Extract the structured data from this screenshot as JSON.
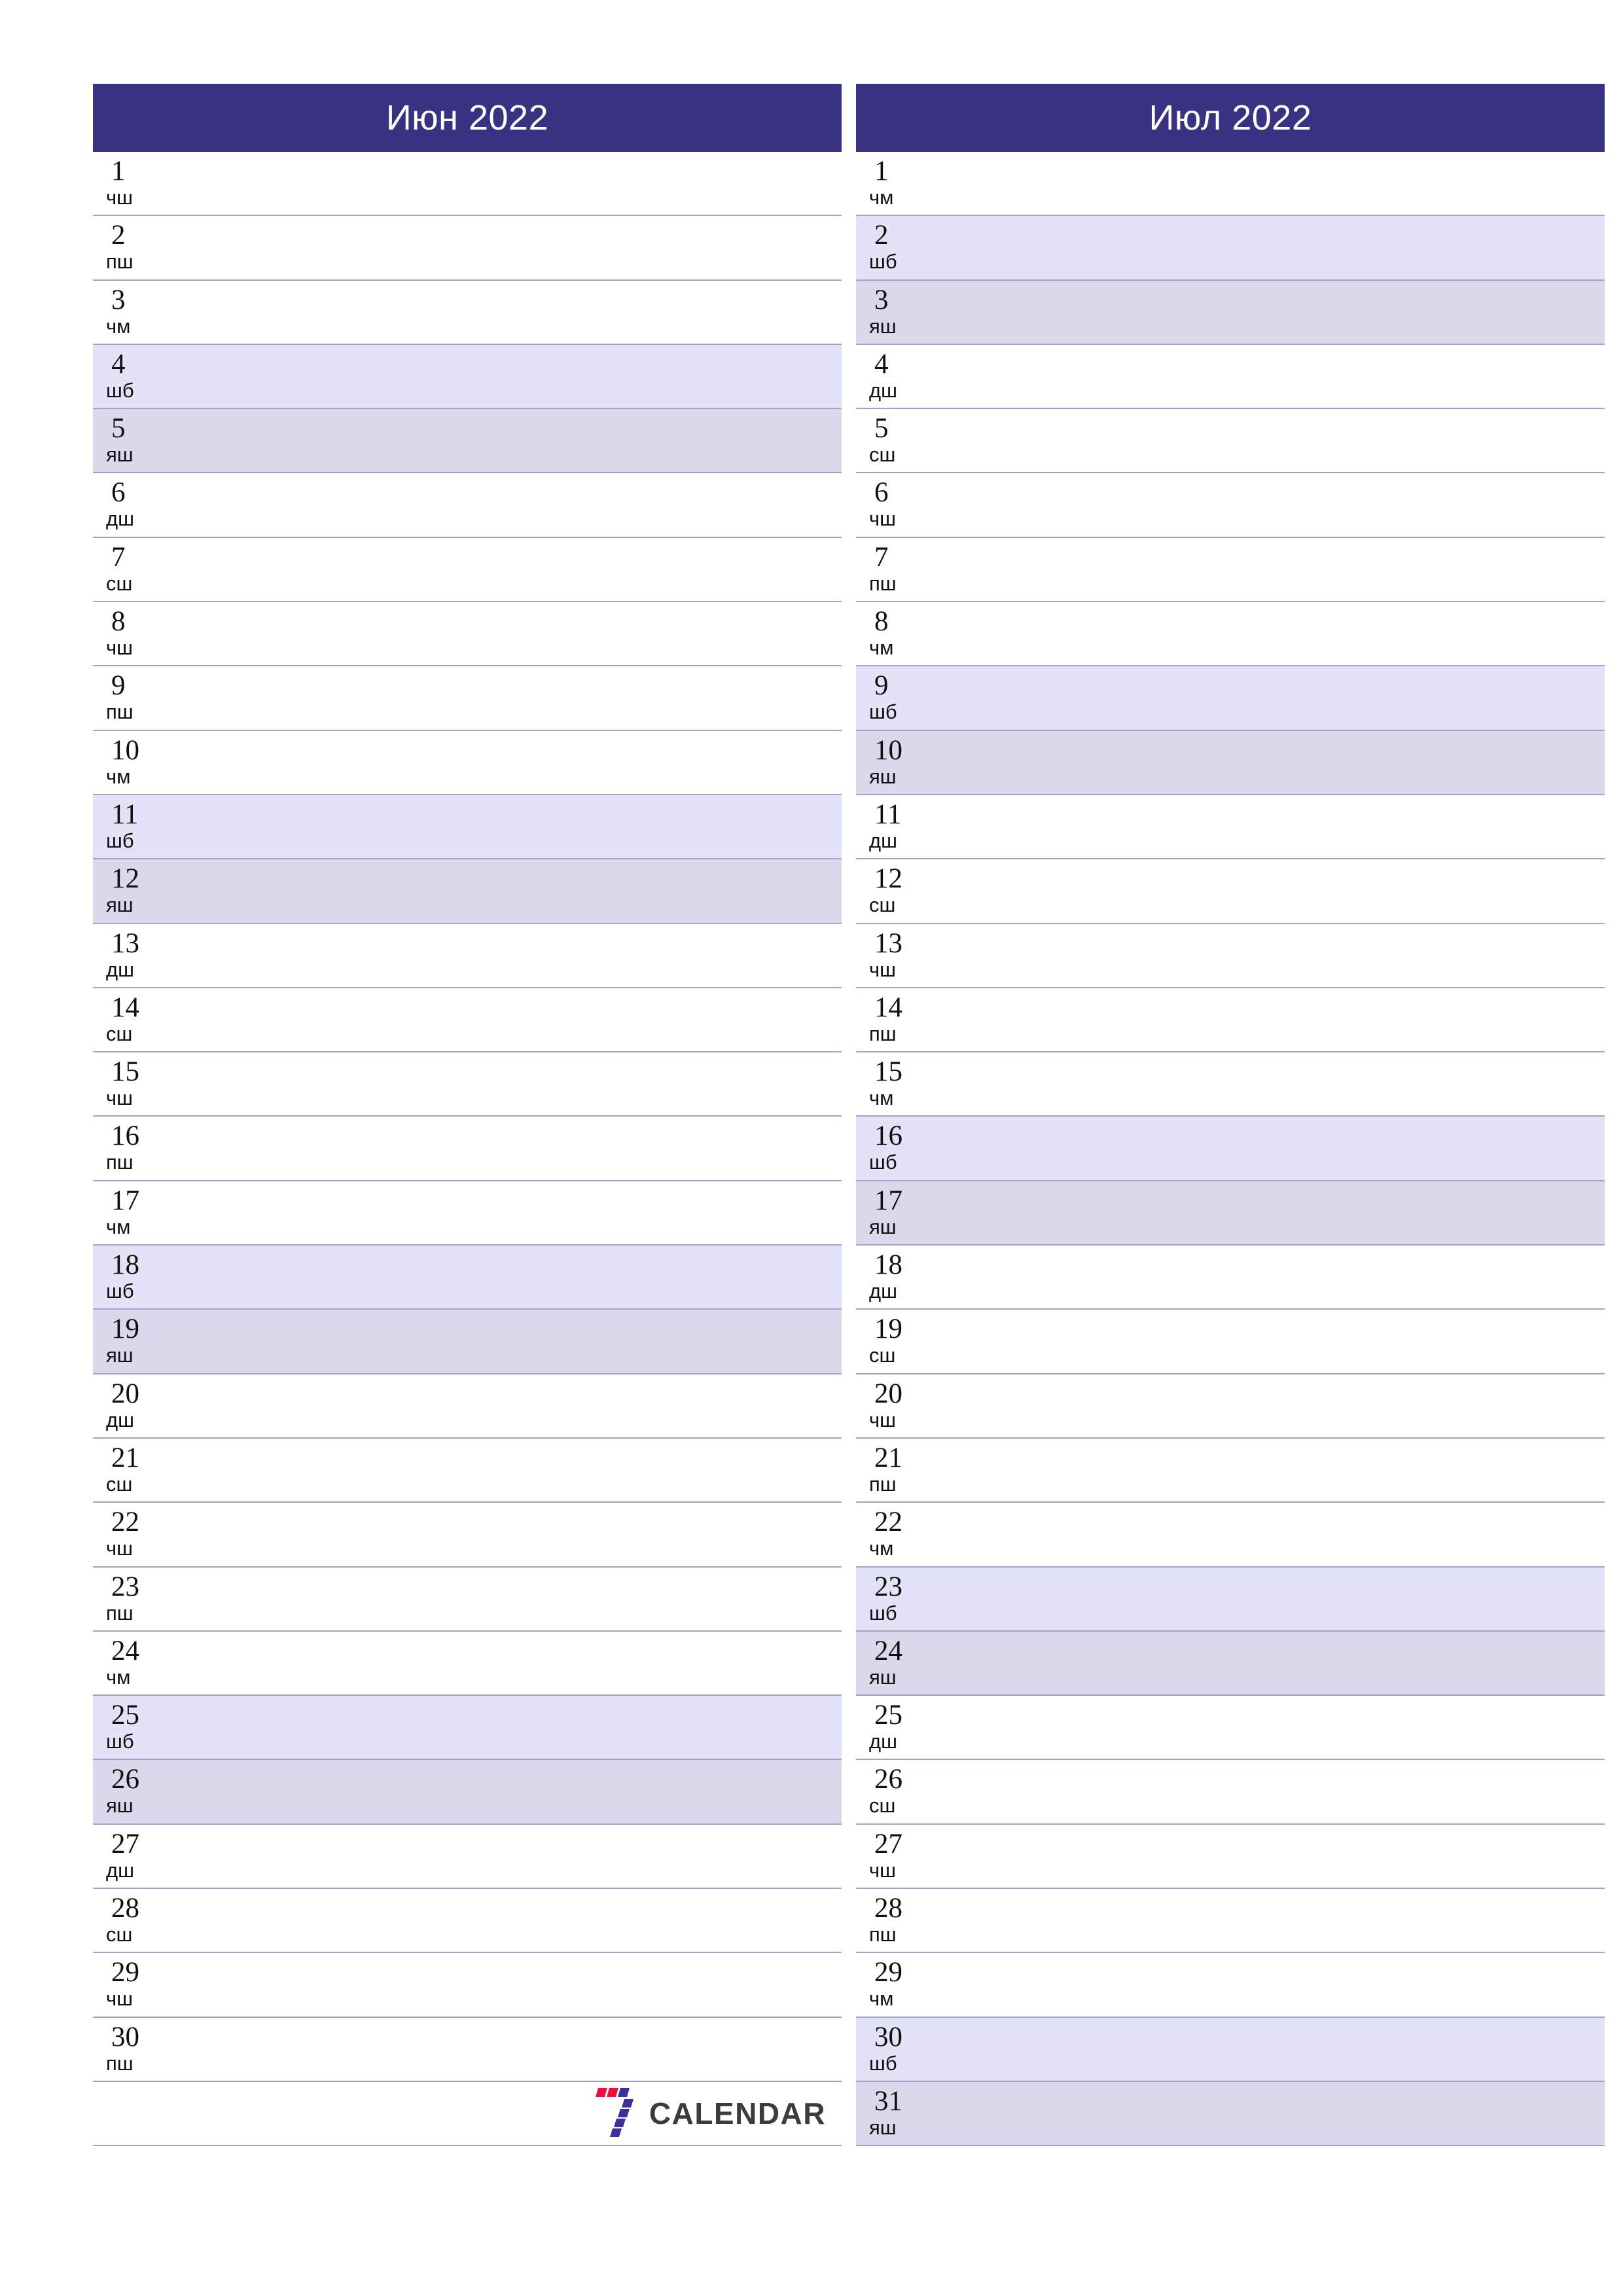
{
  "theme": {
    "header_bg": "#393182",
    "header_text": "#ffffff",
    "saturday_bg": "#e3e3f7",
    "sunday_bg": "#dcd8ec",
    "row_border": "#a6a0cd",
    "day_text": "#101010",
    "logo_red": "#ec0f3c",
    "logo_blue": "#3b2fa0",
    "logo_text_color": "#3c3c3c"
  },
  "logo": {
    "mark_name": "seven-logo-mark",
    "text": "CALENDAR"
  },
  "months": [
    {
      "title": "Июн 2022",
      "days": [
        {
          "num": "1",
          "abbr": "чш",
          "type": "weekday"
        },
        {
          "num": "2",
          "abbr": "пш",
          "type": "weekday"
        },
        {
          "num": "3",
          "abbr": "чм",
          "type": "weekday"
        },
        {
          "num": "4",
          "abbr": "шб",
          "type": "sat"
        },
        {
          "num": "5",
          "abbr": "яш",
          "type": "sun"
        },
        {
          "num": "6",
          "abbr": "дш",
          "type": "weekday"
        },
        {
          "num": "7",
          "abbr": "сш",
          "type": "weekday"
        },
        {
          "num": "8",
          "abbr": "чш",
          "type": "weekday"
        },
        {
          "num": "9",
          "abbr": "пш",
          "type": "weekday"
        },
        {
          "num": "10",
          "abbr": "чм",
          "type": "weekday"
        },
        {
          "num": "11",
          "abbr": "шб",
          "type": "sat"
        },
        {
          "num": "12",
          "abbr": "яш",
          "type": "sun"
        },
        {
          "num": "13",
          "abbr": "дш",
          "type": "weekday"
        },
        {
          "num": "14",
          "abbr": "сш",
          "type": "weekday"
        },
        {
          "num": "15",
          "abbr": "чш",
          "type": "weekday"
        },
        {
          "num": "16",
          "abbr": "пш",
          "type": "weekday"
        },
        {
          "num": "17",
          "abbr": "чм",
          "type": "weekday"
        },
        {
          "num": "18",
          "abbr": "шб",
          "type": "sat"
        },
        {
          "num": "19",
          "abbr": "яш",
          "type": "sun"
        },
        {
          "num": "20",
          "abbr": "дш",
          "type": "weekday"
        },
        {
          "num": "21",
          "abbr": "сш",
          "type": "weekday"
        },
        {
          "num": "22",
          "abbr": "чш",
          "type": "weekday"
        },
        {
          "num": "23",
          "abbr": "пш",
          "type": "weekday"
        },
        {
          "num": "24",
          "abbr": "чм",
          "type": "weekday"
        },
        {
          "num": "25",
          "abbr": "шб",
          "type": "sat"
        },
        {
          "num": "26",
          "abbr": "яш",
          "type": "sun"
        },
        {
          "num": "27",
          "abbr": "дш",
          "type": "weekday"
        },
        {
          "num": "28",
          "abbr": "сш",
          "type": "weekday"
        },
        {
          "num": "29",
          "abbr": "чш",
          "type": "weekday"
        },
        {
          "num": "30",
          "abbr": "пш",
          "type": "weekday"
        },
        {
          "num": "",
          "abbr": "",
          "type": "blank"
        }
      ]
    },
    {
      "title": "Июл 2022",
      "days": [
        {
          "num": "1",
          "abbr": "чм",
          "type": "weekday"
        },
        {
          "num": "2",
          "abbr": "шб",
          "type": "sat"
        },
        {
          "num": "3",
          "abbr": "яш",
          "type": "sun"
        },
        {
          "num": "4",
          "abbr": "дш",
          "type": "weekday"
        },
        {
          "num": "5",
          "abbr": "сш",
          "type": "weekday"
        },
        {
          "num": "6",
          "abbr": "чш",
          "type": "weekday"
        },
        {
          "num": "7",
          "abbr": "пш",
          "type": "weekday"
        },
        {
          "num": "8",
          "abbr": "чм",
          "type": "weekday"
        },
        {
          "num": "9",
          "abbr": "шб",
          "type": "sat"
        },
        {
          "num": "10",
          "abbr": "яш",
          "type": "sun"
        },
        {
          "num": "11",
          "abbr": "дш",
          "type": "weekday"
        },
        {
          "num": "12",
          "abbr": "сш",
          "type": "weekday"
        },
        {
          "num": "13",
          "abbr": "чш",
          "type": "weekday"
        },
        {
          "num": "14",
          "abbr": "пш",
          "type": "weekday"
        },
        {
          "num": "15",
          "abbr": "чм",
          "type": "weekday"
        },
        {
          "num": "16",
          "abbr": "шб",
          "type": "sat"
        },
        {
          "num": "17",
          "abbr": "яш",
          "type": "sun"
        },
        {
          "num": "18",
          "abbr": "дш",
          "type": "weekday"
        },
        {
          "num": "19",
          "abbr": "сш",
          "type": "weekday"
        },
        {
          "num": "20",
          "abbr": "чш",
          "type": "weekday"
        },
        {
          "num": "21",
          "abbr": "пш",
          "type": "weekday"
        },
        {
          "num": "22",
          "abbr": "чм",
          "type": "weekday"
        },
        {
          "num": "23",
          "abbr": "шб",
          "type": "sat"
        },
        {
          "num": "24",
          "abbr": "яш",
          "type": "sun"
        },
        {
          "num": "25",
          "abbr": "дш",
          "type": "weekday"
        },
        {
          "num": "26",
          "abbr": "сш",
          "type": "weekday"
        },
        {
          "num": "27",
          "abbr": "чш",
          "type": "weekday"
        },
        {
          "num": "28",
          "abbr": "пш",
          "type": "weekday"
        },
        {
          "num": "29",
          "abbr": "чм",
          "type": "weekday"
        },
        {
          "num": "30",
          "abbr": "шб",
          "type": "sat"
        },
        {
          "num": "31",
          "abbr": "яш",
          "type": "sun"
        }
      ]
    }
  ]
}
